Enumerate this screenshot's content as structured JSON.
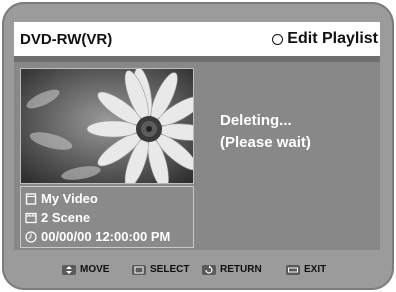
{
  "header": {
    "disc_type": "DVD-RW(VR)",
    "menu_title": "Edit Playlist"
  },
  "status": {
    "line1": "Deleting...",
    "line2": "(Please wait)"
  },
  "info": {
    "title": "My Video",
    "scenes": "2 Scene",
    "datetime": "00/00/00 12:00:00  PM"
  },
  "footer": {
    "move": "MOVE",
    "select": "SELECT",
    "return": "RETURN",
    "exit": "EXIT"
  },
  "icons": {
    "mode": "circle-icon",
    "title": "document-icon",
    "scenes": "film-icon",
    "datetime": "clock-icon",
    "move": "up-down-arrow-icon",
    "select": "enter-icon",
    "return": "return-arrow-icon",
    "exit": "exit-icon"
  }
}
